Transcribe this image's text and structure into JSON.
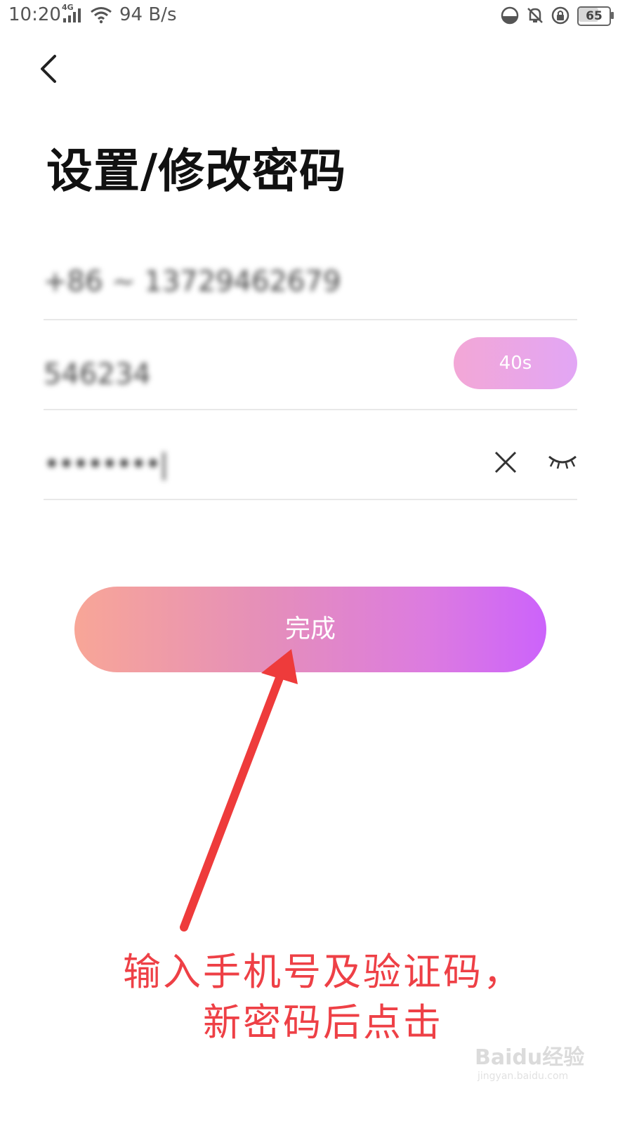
{
  "status_bar": {
    "time": "10:20",
    "network": "4G",
    "speed": "94 B/s",
    "battery": "65"
  },
  "header": {
    "back_icon": "chevron-left-icon",
    "title": "设置/修改密码"
  },
  "form": {
    "phone_value": "+86 ~ 13729462679",
    "code_value": "546234",
    "countdown_label": "40s",
    "password_value": "••••••••|",
    "clear_icon": "close-icon",
    "visibility_icon": "eye-closed-icon"
  },
  "done_button": {
    "label": "完成"
  },
  "annotation": {
    "line1": "输入手机号及验证码，",
    "line2": "新密码后点击",
    "color": "#ee4046"
  },
  "watermark": {
    "brand": "Baidu经验",
    "url": "jingyan.baidu.com"
  },
  "colors": {
    "accent_start": "#f8a697",
    "accent_end": "#cc63fb"
  }
}
